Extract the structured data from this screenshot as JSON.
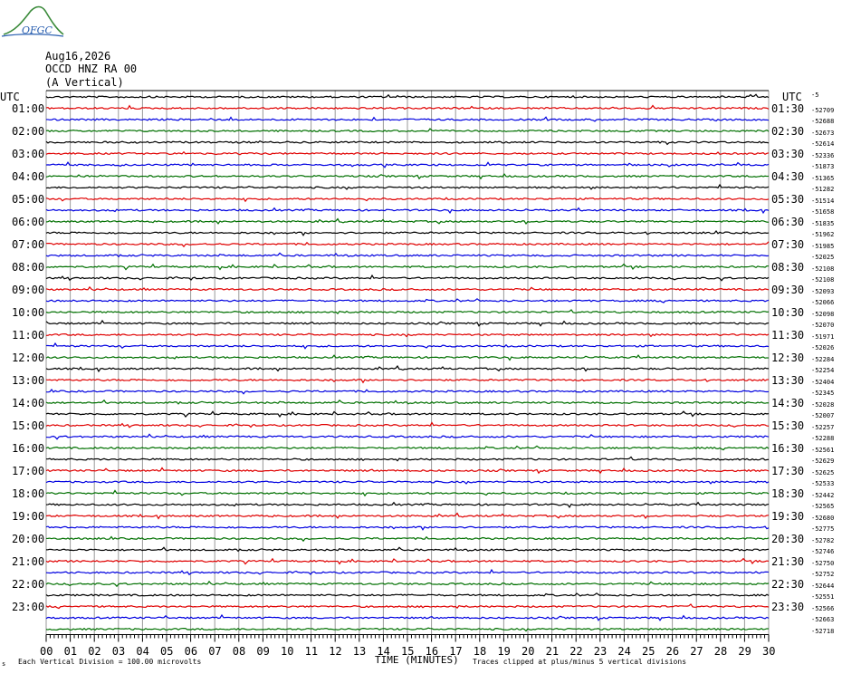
{
  "header": {
    "logo_text": "OFGC",
    "date": "Aug16,2026",
    "station": "OCCD HNZ RA 00",
    "component": "(A Vertical)"
  },
  "chart_data": {
    "type": "line",
    "left_axis_title": "UTC",
    "right_axis_title": "UTC",
    "right_axis_title_note": "-5",
    "left_labels": [
      "01:00",
      "02:00",
      "03:00",
      "04:00",
      "05:00",
      "06:00",
      "07:00",
      "08:00",
      "09:00",
      "10:00",
      "11:00",
      "12:00",
      "13:00",
      "14:00",
      "15:00",
      "16:00",
      "17:00",
      "18:00",
      "19:00",
      "20:00",
      "21:00",
      "22:00",
      "23:00"
    ],
    "right_labels": [
      "01:30",
      "02:30",
      "03:30",
      "04:30",
      "05:30",
      "06:30",
      "07:30",
      "08:30",
      "09:30",
      "10:30",
      "11:30",
      "12:30",
      "13:30",
      "14:30",
      "15:30",
      "16:30",
      "17:30",
      "18:30",
      "19:30",
      "20:30",
      "21:30",
      "22:30",
      "23:30"
    ],
    "trace_offsets": [
      "-52709",
      "-52688",
      "-52673",
      "-52614",
      "-52336",
      "-51873",
      "-51365",
      "-51282",
      "-51514",
      "-51658",
      "-51835",
      "-51962",
      "-51985",
      "-52025",
      "-52108",
      "-52108",
      "-52093",
      "-52066",
      "-52098",
      "-52070",
      "-51971",
      "-52026",
      "-52284",
      "-52254",
      "-52404",
      "-52345",
      "-52028",
      "-52007",
      "-52257",
      "-52288",
      "-52561",
      "-52629",
      "-52625",
      "-52533",
      "-52442",
      "-52565",
      "-52680",
      "-52775",
      "-52782",
      "-52746",
      "-52750",
      "-52752",
      "-52644",
      "-52551",
      "-52566",
      "-52663",
      "-52718"
    ],
    "trace_colors": [
      "#000000",
      "#e00000",
      "#0000e0",
      "#007000"
    ],
    "trace_count": 48,
    "x_ticks": [
      "00",
      "01",
      "02",
      "03",
      "04",
      "05",
      "06",
      "07",
      "08",
      "09",
      "10",
      "11",
      "12",
      "13",
      "14",
      "15",
      "16",
      "17",
      "18",
      "19",
      "20",
      "21",
      "22",
      "23",
      "24",
      "25",
      "26",
      "27",
      "28",
      "29",
      "30"
    ],
    "xlim": [
      0,
      30
    ],
    "xlabel": "TIME (MINUTES)",
    "scale_note": "Each Vertical Division =  100.00 microvolts",
    "clip_note": "Traces clipped at plus/minus 5 vertical divisions",
    "corner_mark": "s",
    "grid": true
  }
}
